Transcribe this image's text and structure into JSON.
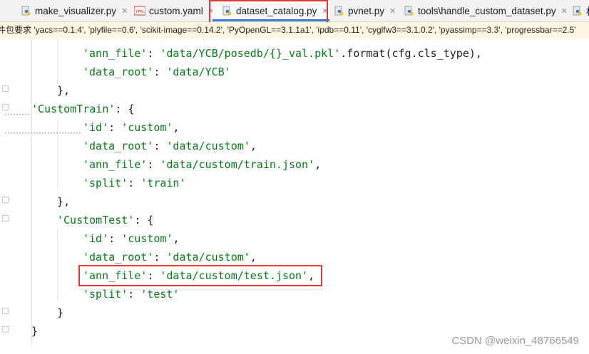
{
  "tabs": [
    {
      "label": "make_visualizer.py",
      "icon": "python-file-icon",
      "active": false,
      "closable": true
    },
    {
      "label": "custom.yaml",
      "icon": "yaml-file-icon",
      "active": false,
      "closable": true
    },
    {
      "label": "dataset_catalog.py",
      "icon": "python-file-icon",
      "active": true,
      "closable": true
    },
    {
      "label": "pvnet.py",
      "icon": "python-file-icon",
      "active": false,
      "closable": true
    },
    {
      "label": "tools\\handle_custom_dataset.py",
      "icon": "python-file-icon",
      "active": false,
      "closable": true
    },
    {
      "label": "析",
      "icon": "python-file-icon",
      "active": false,
      "closable": false
    }
  ],
  "close_glyph": "✕",
  "requirements_banner": "件包要求 'yacs==0.1.4', 'plyfile==0.6', 'scikit-image==0.14.2', 'PyOpenGL==3.1.1a1', 'ipdb==0.11', 'cyglfw3==3.1.0.2', 'pyassimp==3.3', 'progressbar==2.5'",
  "code_lines": [
    [
      {
        "t": "'ann_file'",
        "c": "s"
      },
      {
        "t": ": ",
        "c": "p"
      },
      {
        "t": "'data/YCB/posedb/{}_val.pkl'",
        "c": "s"
      },
      {
        "t": ".format(cfg.cls_type),",
        "c": "p"
      }
    ],
    [
      {
        "t": "'data_root'",
        "c": "s"
      },
      {
        "t": ": ",
        "c": "p"
      },
      {
        "t": "'data/YCB'",
        "c": "s"
      }
    ],
    [
      {
        "t": "},",
        "c": "p"
      }
    ],
    [
      {
        "t": "'CustomTrain'",
        "c": "s"
      },
      {
        "t": ": {",
        "c": "p"
      }
    ],
    [
      {
        "t": "'id'",
        "c": "s"
      },
      {
        "t": ": ",
        "c": "p"
      },
      {
        "t": "'custom'",
        "c": "s"
      },
      {
        "t": ",",
        "c": "p"
      }
    ],
    [
      {
        "t": "'data_root'",
        "c": "s"
      },
      {
        "t": ": ",
        "c": "p"
      },
      {
        "t": "'data/custom'",
        "c": "s"
      },
      {
        "t": ",",
        "c": "p"
      }
    ],
    [
      {
        "t": "'ann_file'",
        "c": "s"
      },
      {
        "t": ": ",
        "c": "p"
      },
      {
        "t": "'data/custom/train.json'",
        "c": "s"
      },
      {
        "t": ",",
        "c": "p"
      }
    ],
    [
      {
        "t": "'split'",
        "c": "s"
      },
      {
        "t": ": ",
        "c": "p"
      },
      {
        "t": "'train'",
        "c": "s"
      }
    ],
    [
      {
        "t": "},",
        "c": "p"
      }
    ],
    [
      {
        "t": "'CustomTest'",
        "c": "s"
      },
      {
        "t": ": {",
        "c": "p"
      }
    ],
    [
      {
        "t": "'id'",
        "c": "s"
      },
      {
        "t": ": ",
        "c": "p"
      },
      {
        "t": "'custom'",
        "c": "s"
      },
      {
        "t": ",",
        "c": "p"
      }
    ],
    [
      {
        "t": "'data_root'",
        "c": "s"
      },
      {
        "t": ": ",
        "c": "p"
      },
      {
        "t": "'data/custom'",
        "c": "s"
      },
      {
        "t": ",",
        "c": "p"
      }
    ],
    [
      {
        "t": "'ann_file'",
        "c": "s"
      },
      {
        "t": ": ",
        "c": "p"
      },
      {
        "t": "'data/custom/test.json'",
        "c": "s"
      },
      {
        "t": ",",
        "c": "p"
      }
    ],
    [
      {
        "t": "'split'",
        "c": "s"
      },
      {
        "t": ": ",
        "c": "p"
      },
      {
        "t": "'test'",
        "c": "s"
      }
    ],
    [
      {
        "t": "}",
        "c": "p"
      }
    ],
    [
      {
        "t": "}",
        "c": "p"
      }
    ]
  ],
  "colors": {
    "string": "#067d17",
    "highlight_box": "#e53935",
    "active_tab_underline": "#3d7bd9"
  },
  "watermark": "CSDN @weixin_48766549"
}
